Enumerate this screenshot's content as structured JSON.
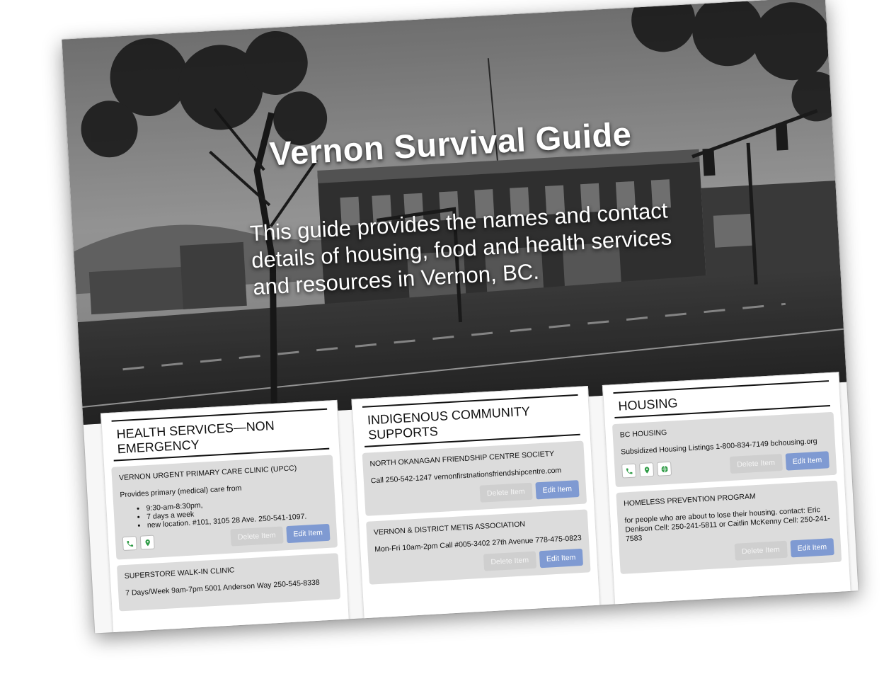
{
  "hero": {
    "title": "Vernon Survival Guide",
    "subtitle": "This guide provides the names and contact details of housing, food and health services and resources in Vernon, BC."
  },
  "buttons": {
    "delete_label": "Delete Item",
    "edit_label": "Edit Item"
  },
  "colors": {
    "edit_button": "#7f9ad2",
    "delete_button": "#cfcfcf",
    "icon_green": "#2e9b45",
    "item_background": "#dcdcdc"
  },
  "columns": [
    {
      "title": "HEALTH SERVICES—NON EMERGENCY",
      "items": [
        {
          "title": "VERNON URGENT PRIMARY CARE CLINIC (UPCC)",
          "description": "Provides primary (medical) care from",
          "bullets": [
            "9:30-am-8:30pm,",
            "7 days a week",
            "new location. #101, 3105 28 Ave. 250-541-1097."
          ],
          "icons": [
            "phone-icon",
            "map-pin-icon"
          ]
        },
        {
          "title": "SUPERSTORE WALK-IN CLINIC",
          "description": "7 Days/Week 9am-7pm 5001 Anderson Way 250-545-8338"
        }
      ]
    },
    {
      "title": "INDIGENOUS COMMUNITY SUPPORTS",
      "items": [
        {
          "title": "NORTH OKANAGAN FRIENDSHIP CENTRE SOCIETY",
          "description": "Call 250-542-1247 vernonfirstnationsfriendshipcentre.com"
        },
        {
          "title": "VERNON & DISTRICT METIS ASSOCIATION",
          "description": "Mon-Fri 10am-2pm Call #005-3402 27th Avenue 778-475-0823"
        }
      ]
    },
    {
      "title": "HOUSING",
      "items": [
        {
          "title": "BC HOUSING",
          "description": "Subsidized Housing Listings 1-800-834-7149 bchousing.org",
          "icons": [
            "phone-icon",
            "map-pin-icon",
            "globe-icon"
          ]
        },
        {
          "title": "HOMELESS PREVENTION PROGRAM",
          "description": "for people who are about to lose their housing. contact: Eric Denison Cell: 250-241-5811 or Caitlin McKenny Cell: 250-241-7583"
        }
      ]
    }
  ]
}
